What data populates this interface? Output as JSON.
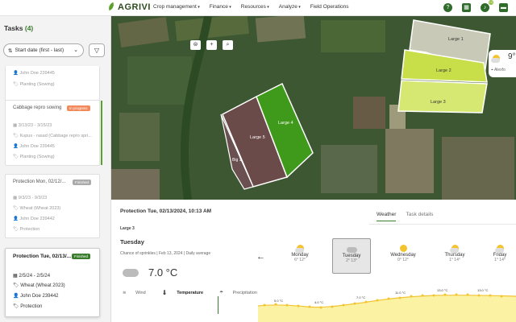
{
  "app": {
    "logo_text": "AGRIVI"
  },
  "nav": {
    "items": [
      "Crop management",
      "Finance",
      "Resources",
      "Analyze",
      "Field Operations"
    ]
  },
  "top_icons": {
    "help": "help-icon",
    "calendar": "calendar-icon",
    "notifications": "bell-icon",
    "notifications_badge": "10",
    "chat": "chat-icon"
  },
  "sidebar": {
    "title": "Tasks",
    "count": "(4)",
    "sort_label": "Start date (first - last)",
    "cards": [
      {
        "title": "",
        "status": "",
        "lines": [
          "John Doe 239445",
          "Planting (Sowing)"
        ]
      },
      {
        "title": "Cabbage repro sowing",
        "status": "In progress",
        "lines": [
          "3/13/23 - 3/15/23",
          "Kupus - rasad (Cabbage repro spri...",
          "John Doe 239445",
          "Planting (Sowing)"
        ]
      },
      {
        "title": "Protection Mon, 02/12/...",
        "status": "Finished",
        "lines": [
          "9/3/23 - 9/3/23",
          "Wheat (Wheat 2023)",
          "John Doe 239442",
          "Protection"
        ]
      },
      {
        "title": "Protection Tue, 02/13/...",
        "status": "Finished",
        "lines": [
          "2/5/24 - 2/5/24",
          "Wheat (Wheat 2023)",
          "John Doe 239442",
          "Protection"
        ]
      }
    ]
  },
  "map": {
    "fields": [
      "Large 1",
      "Large 2",
      "Large 3",
      "Large 4",
      "Large 5",
      "Big 1"
    ],
    "popup_temp": "9°",
    "popup_place": "Alexfo"
  },
  "panel": {
    "title": "Protection Tue, 02/13/2024, 10:13 AM",
    "tabs": [
      "Weather",
      "Task details"
    ],
    "field": "Large 3",
    "day": "Tuesday",
    "chance": "Chance of sprinkles",
    "date": "Feb 13, 2024",
    "avg": "Daily average",
    "temp": "7.0 °C",
    "legend": [
      "Wind",
      "Temperature",
      "Precipitation"
    ],
    "days": [
      {
        "name": "Monday",
        "range": "6° 12°",
        "icon": "sun-cloud-icon"
      },
      {
        "name": "Tuesday",
        "range": "2° 13°",
        "icon": "cloud-icon"
      },
      {
        "name": "Wednesday",
        "range": "0° 12°",
        "icon": "sun-icon"
      },
      {
        "name": "Thursday",
        "range": "1° 14°",
        "icon": "sun-cloud-icon"
      },
      {
        "name": "Friday",
        "range": "1° 14°",
        "icon": "sun-cloud-icon"
      }
    ],
    "graph_labels": [
      "5.0 °C",
      "4.0 °C",
      "7.0 °C",
      "11.0 °C",
      "13.0 °C",
      "13.0 °C"
    ]
  },
  "colors": {
    "brand": "#3a7d2c",
    "accent": "#8fbf3c",
    "in_progress": "#f28a5c"
  }
}
